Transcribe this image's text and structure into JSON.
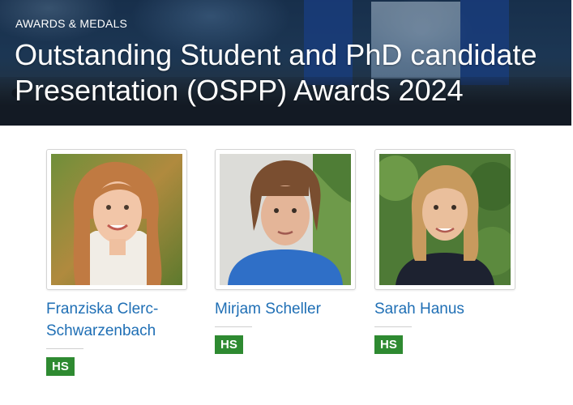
{
  "hero": {
    "kicker": "AWARDS & MEDALS",
    "title": "Outstanding Student and PhD candidate Presentation (OSPP) Awards 2024"
  },
  "awardees": [
    {
      "name": "Franziska Clerc-Schwarzenbach",
      "badge": "HS"
    },
    {
      "name": "Mirjam Scheller",
      "badge": "HS"
    },
    {
      "name": "Sarah Hanus",
      "badge": "HS"
    }
  ],
  "colors": {
    "link": "#1f6fb5",
    "badge_bg": "#2e8a31"
  }
}
